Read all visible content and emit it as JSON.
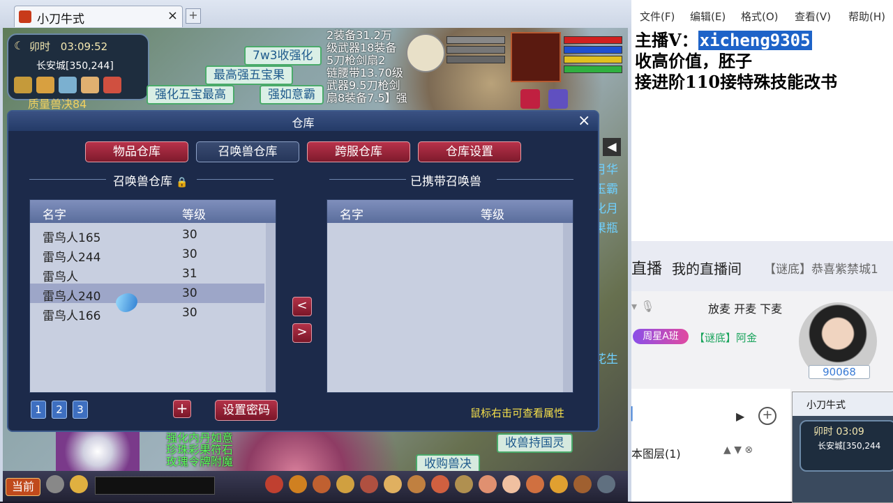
{
  "game": {
    "tab_title": "小刀牛式",
    "tab_close": "×",
    "new_tab": "+",
    "clock": {
      "period": "卯时",
      "time": "03:09:52",
      "city": "长安城[350,244]"
    },
    "bubbles": [
      "7w3收强化",
      "最高强五宝果",
      "强化五宝最高",
      "强如意霸"
    ],
    "rank_name": "质量兽决84",
    "boss_info": [
      "2装备31.2万",
      "级武器18装备",
      "5刀枪剑扇2",
      "链腰带13.70级",
      "武器9.5刀枪剑",
      "扇8装备7.5】强"
    ],
    "right_strip": [
      "月华",
      "玉霸",
      "化月",
      "果瓶",
      "",
      "",
      "",
      "",
      "",
      "",
      "花生"
    ],
    "chat_bottom": [
      "强化内丹如意",
      "珍珠彩果符石",
      "玫瑰令牌附魔"
    ],
    "bubble_bottom1": "收兽持国灵",
    "bubble_bottom2": "收购兽决",
    "current_button": "当前"
  },
  "warehouse": {
    "title": "仓库",
    "close": "×",
    "tabs": [
      "物品仓库",
      "召唤兽仓库",
      "跨服仓库",
      "仓库设置"
    ],
    "active_tab": 1,
    "left_section": "召唤兽仓库",
    "right_section": "已携带召唤兽",
    "col_name": "名字",
    "col_level": "等级",
    "rows": [
      {
        "name": "雷鸟人165",
        "level": "30"
      },
      {
        "name": "雷鸟人244",
        "level": "30"
      },
      {
        "name": "雷鸟人",
        "level": "31"
      },
      {
        "name": "雷鸟人240",
        "level": "30"
      },
      {
        "name": "雷鸟人166",
        "level": "30"
      }
    ],
    "selected_row": 3,
    "move_left": "<",
    "move_right": ">",
    "pages": [
      "1",
      "2",
      "3"
    ],
    "add_button": "+",
    "password_button": "设置密码",
    "hint": "鼠标右击可查看属性"
  },
  "notepad": {
    "menu": [
      "文件(F)",
      "编辑(E)",
      "格式(O)",
      "查看(V)",
      "帮助(H)"
    ],
    "line1_prefix": "主播V：",
    "line1_wechat": "xicheng9305",
    "line2": "收高价值，胚子",
    "line3": "接进阶110接特殊技能改书"
  },
  "stream": {
    "logo": "直播",
    "my_room": "我的直播间",
    "room_title": "【谜底】恭喜紫禁城1",
    "mic_controls": "放麦 开麦 下麦",
    "badge": "周星A班",
    "member": "【谜底】阿金",
    "fans": "90068",
    "layer": "本图层(1)",
    "mini_tab": "小刀牛式",
    "mini_clock_period": "卯时",
    "mini_clock_time": "03:09",
    "mini_city": "长安城[350,244"
  }
}
